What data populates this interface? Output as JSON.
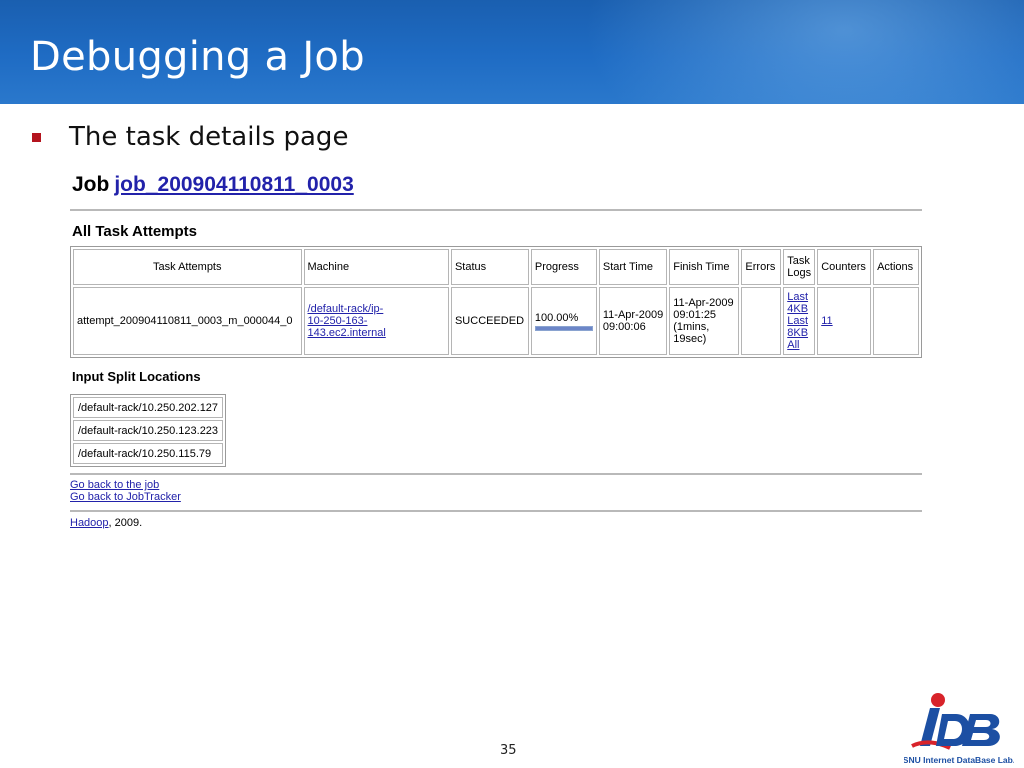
{
  "slide": {
    "title": "Debugging a Job",
    "bullet": "The task details page",
    "page_number": "35"
  },
  "screenshot": {
    "job_prefix": "Job",
    "job_id": "job_200904110811_0003",
    "attempts_heading": "All Task Attempts",
    "columns": [
      "Task Attempts",
      "Machine",
      "Status",
      "Progress",
      "Start Time",
      "Finish Time",
      "Errors",
      "Task Logs",
      "Counters",
      "Actions"
    ],
    "row": {
      "attempt": "attempt_200904110811_0003_m_000044_0",
      "machine_line1": "/default-rack/ip-",
      "machine_line2": "10-250-163-143.ec2.internal",
      "status": "SUCCEEDED",
      "progress": "100.00%",
      "progress_fraction": 1.0,
      "start_line1": "11-Apr-2009",
      "start_line2": "09:00:06",
      "finish_line1": "11-Apr-2009",
      "finish_line2": "09:01:25",
      "finish_line3": "(1mins,",
      "finish_line4": "19sec)",
      "errors": "",
      "logs": [
        "Last",
        "4KB",
        "Last",
        "8KB",
        "All"
      ],
      "counters": "11",
      "actions": ""
    },
    "splits_heading": "Input Split Locations",
    "splits": [
      "/default-rack/10.250.202.127",
      "/default-rack/10.250.123.223",
      "/default-rack/10.250.115.79"
    ],
    "link_job": "Go back to the job",
    "link_tracker": "Go back to JobTracker",
    "hadoop_link": "Hadoop",
    "copyright_suffix": ", 2009."
  },
  "logo": {
    "tagline": "SNU Internet DataBase Lab."
  },
  "colors": {
    "title_bar": "#1f6cc4",
    "bullet": "#b4141e",
    "link": "#2222aa",
    "logo_blue": "#1c4fa3",
    "logo_red": "#d8232a"
  }
}
